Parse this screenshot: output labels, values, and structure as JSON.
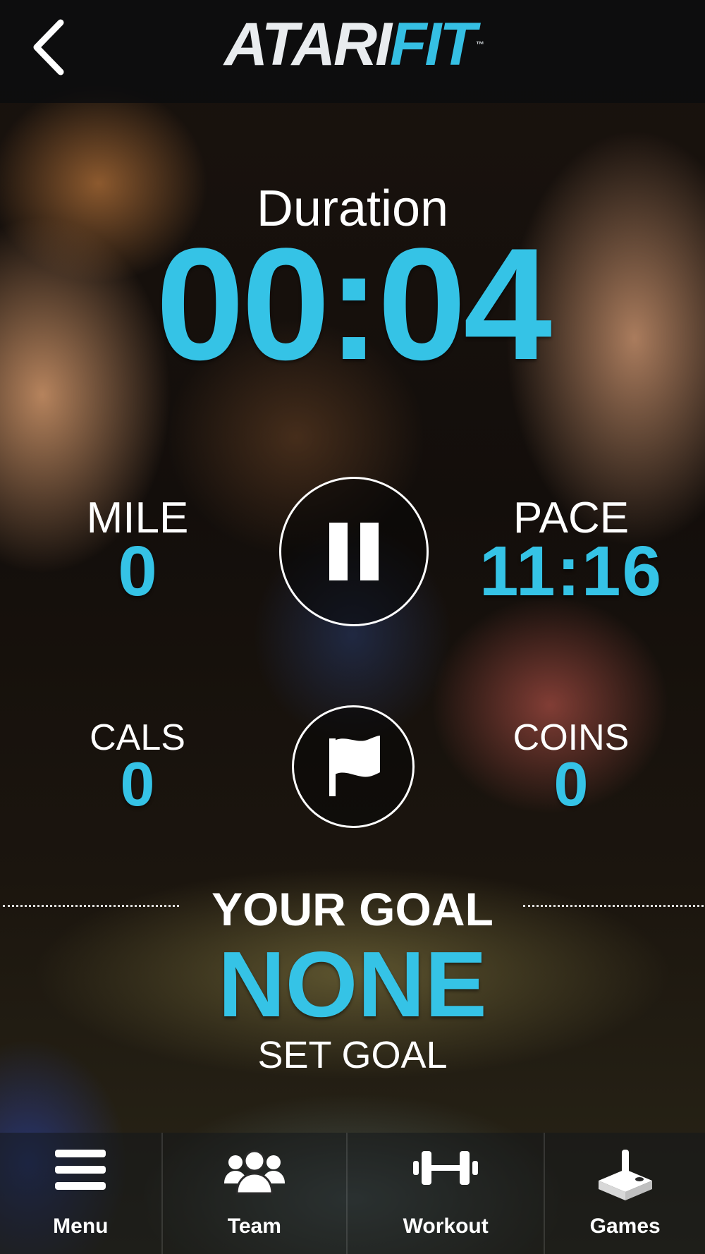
{
  "app": {
    "logo_part1": "ATARI",
    "logo_part2": "FIT",
    "logo_tm": "™"
  },
  "header": {
    "back_icon": "chevron-left-icon"
  },
  "workout": {
    "duration_label": "Duration",
    "duration_value": "00:04",
    "mile_label": "MILE",
    "mile_value": "0",
    "pace_label": "PACE",
    "pace_value": "11:16",
    "cals_label": "CALS",
    "cals_value": "0",
    "coins_label": "COINS",
    "coins_value": "0",
    "pause_icon": "pause-icon",
    "flag_icon": "flag-icon"
  },
  "goal": {
    "label": "YOUR GOAL",
    "value": "NONE",
    "set_goal": "SET GOAL"
  },
  "nav": {
    "items": [
      {
        "label": "Menu",
        "icon": "hamburger-menu-icon"
      },
      {
        "label": "Team",
        "icon": "team-icon"
      },
      {
        "label": "Workout",
        "icon": "dumbbell-icon"
      },
      {
        "label": "Games",
        "icon": "joystick-icon"
      }
    ]
  },
  "colors": {
    "accent": "#35c3e6",
    "text": "#ffffff",
    "header_bg": "#0a0c0e"
  }
}
